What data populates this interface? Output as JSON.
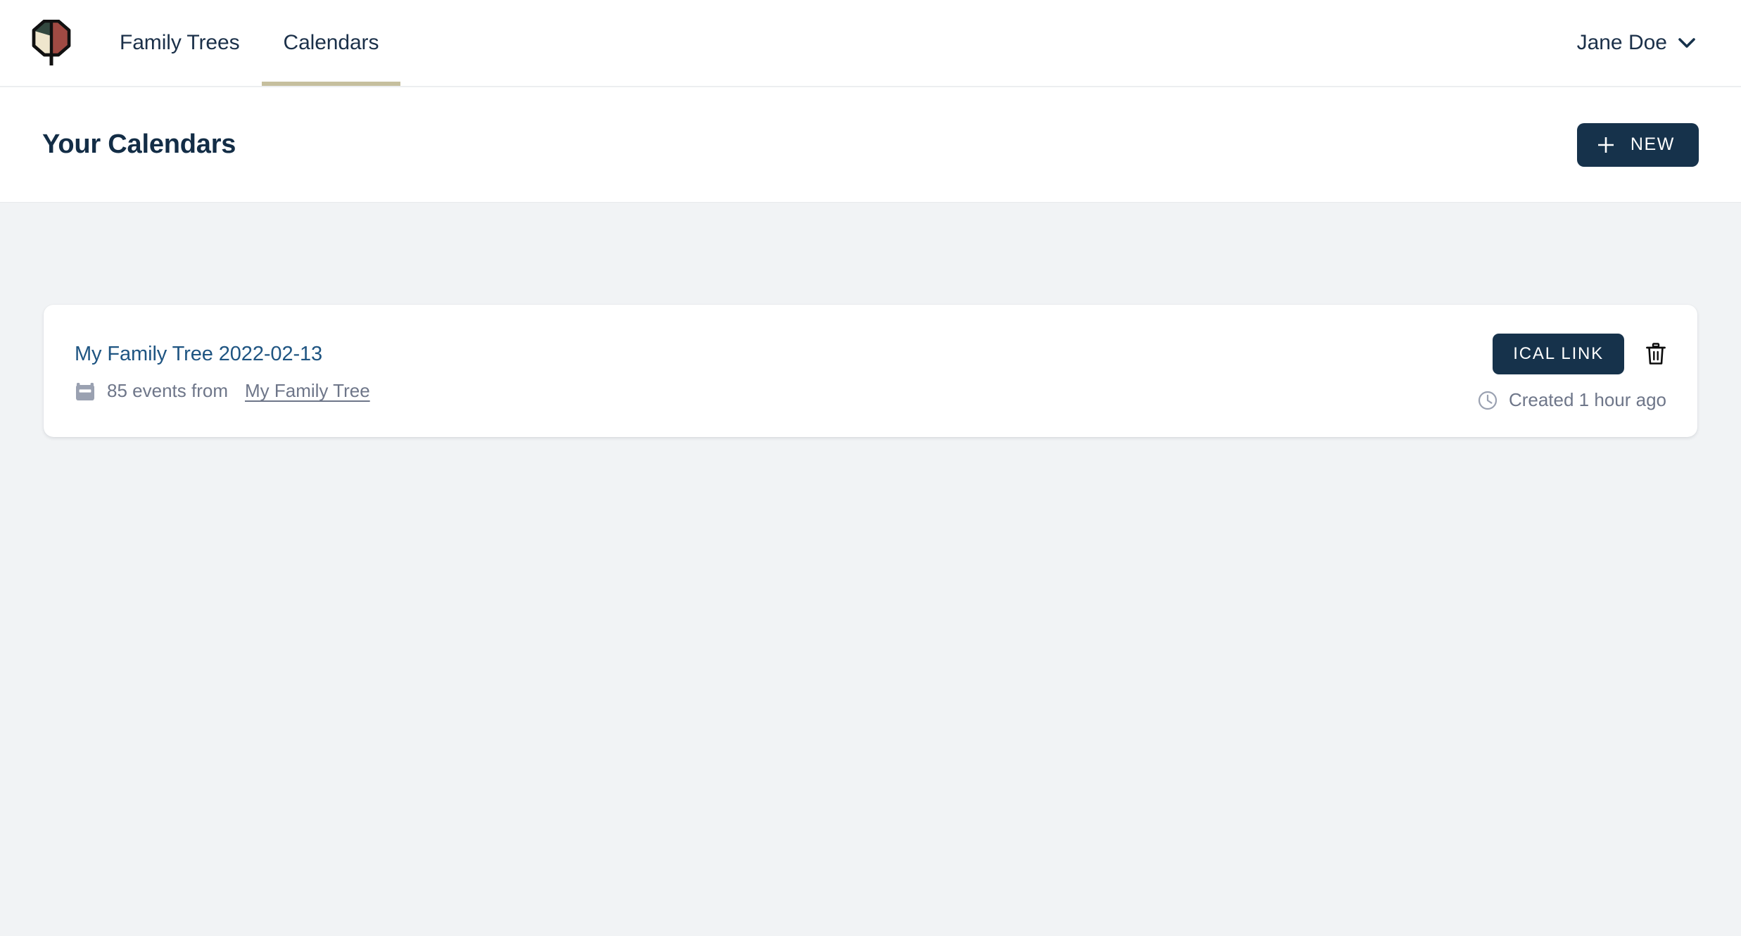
{
  "navbar": {
    "logo_name": "family-tree-logo",
    "logo_colors": {
      "leaf_green": "#33483f",
      "leaf_cream": "#efe6cd",
      "leaf_red": "#a04a43",
      "outline": "#111111"
    },
    "tabs": [
      {
        "label": "Family Trees",
        "active": false
      },
      {
        "label": "Calendars",
        "active": true
      }
    ],
    "active_tab_indicator_color": "#c6bf9e",
    "user": {
      "name": "Jane Doe",
      "chevron_icon": "chevron-down-icon"
    }
  },
  "title_band": {
    "title": "Your Calendars",
    "new_button": {
      "label": "NEW",
      "icon": "plus-icon",
      "background": "#16324b",
      "text_color": "#ffffff"
    }
  },
  "calendars": [
    {
      "name": "My Family Tree 2022-02-13",
      "name_color": "#1f5582",
      "events_text": "85 events from",
      "events_count": 85,
      "source_name": "My Family Tree",
      "calendar_icon": "calendar-icon",
      "ical_button_label": "ICAL LINK",
      "delete_icon": "trash-icon",
      "clock_icon": "clock-icon",
      "created_text": "Created 1 hour ago"
    }
  ],
  "theme": {
    "page_background": "#f1f3f5",
    "surface": "#ffffff",
    "primary_dark": "#16324b",
    "link_blue": "#1f5582",
    "muted_text": "#6e7689",
    "heading": "#132d46"
  }
}
